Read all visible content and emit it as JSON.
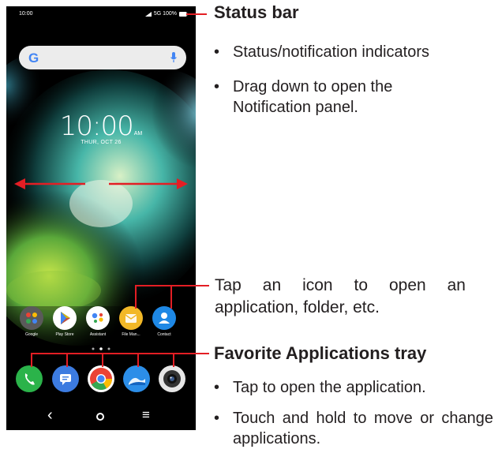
{
  "phone": {
    "status_time": "10:00",
    "status_right": "5G 100%",
    "search_logo": "G",
    "clock_time": "10:00",
    "clock_ampm": "AM",
    "clock_date": "THUR, OCT 26",
    "apps": [
      {
        "label": "Google",
        "icon": "google-folder-icon",
        "color": "#4a4a4a"
      },
      {
        "label": "Play Store",
        "icon": "play-store-icon",
        "color": "#ffffff"
      },
      {
        "label": "Assistant",
        "icon": "assistant-icon",
        "color": "#ffffff"
      },
      {
        "label": "File Man...",
        "icon": "file-manager-icon",
        "color": "#f2b827"
      },
      {
        "label": "Contact",
        "icon": "contact-icon",
        "color": "#1e88e5"
      }
    ],
    "tray": [
      {
        "icon": "phone-icon",
        "color": "#2bb34a"
      },
      {
        "icon": "messages-icon",
        "color": "#3c7be0"
      },
      {
        "icon": "chrome-icon",
        "color": "#ffffff"
      },
      {
        "icon": "gallery-icon",
        "color": "#2c8ee8"
      },
      {
        "icon": "camera-icon",
        "color": "#e6e6e6"
      }
    ],
    "nav_back": "‹",
    "nav_home": "●",
    "nav_menu": "≡"
  },
  "callouts": {
    "status_bar_title": "Status bar",
    "status_bullets": [
      "Status/notification indicators",
      "Drag down to open the Notification panel."
    ],
    "tap_icon_text": "Tap an icon to open an application, folder, etc.",
    "tray_title": "Favorite Applications tray",
    "tray_bullets": [
      "Tap to open the application.",
      "Touch and hold to move or change applications."
    ],
    "bullet_char": "•"
  },
  "colors": {
    "callout_line": "#e31e24",
    "swipe_arrow": "#e31e24",
    "text": "#231f20"
  }
}
